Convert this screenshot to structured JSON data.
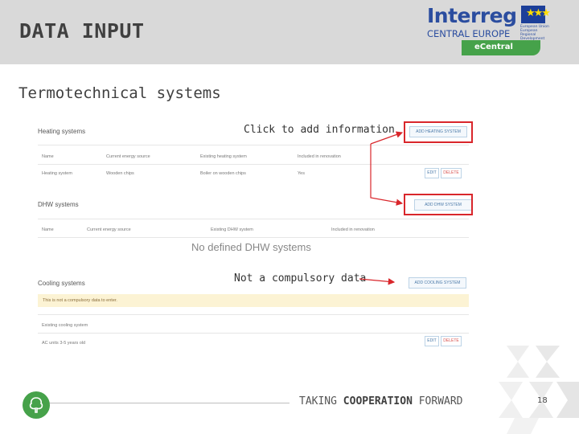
{
  "slide": {
    "title": "DATA INPUT",
    "section_title": "Termotechnical systems"
  },
  "logo": {
    "interreg": "Interreg",
    "central_europe": "CENTRAL EUROPE",
    "eu_text": "European Union European Regional Development Fund",
    "ecentral": "eCentral",
    "brand_color": "#2b4d9f",
    "green_color": "#46a24a"
  },
  "app": {
    "heating": {
      "title": "Heating systems",
      "add_button": "ADD HEATING SYSTEM",
      "columns": [
        "Name",
        "Current energy source",
        "Existing heating system",
        "Included in renovation"
      ],
      "rows": [
        {
          "name": "Heating system",
          "source": "Wooden chips",
          "system": "Boiler on wooden chips",
          "included": "Yes"
        }
      ],
      "edit_label": "EDIT",
      "delete_label": "DELETE"
    },
    "dhw": {
      "title": "DHW systems",
      "add_button": "ADD DHW SYSTEM",
      "columns": [
        "Name",
        "Current energy source",
        "Existing DHW system",
        "Included in renovation"
      ],
      "empty_message": "No defined DHW systems"
    },
    "cooling": {
      "title": "Cooling systems",
      "add_button": "ADD COOLING SYSTEM",
      "notice": "This is not a compulsory data to enter.",
      "column": "Existing cooling system",
      "rows": [
        {
          "system": "AC units 3-5 years old"
        }
      ],
      "edit_label": "EDIT",
      "delete_label": "DELETE"
    }
  },
  "callouts": {
    "add_info": "Click to add information",
    "not_compulsory": "Not a compulsory data"
  },
  "footer": {
    "text_pre": "TAKING ",
    "text_bold": "COOPERATION",
    "text_post": " FORWARD",
    "page_number": "18"
  },
  "colors": {
    "highlight": "#d9262b",
    "header_bg": "#d9d9d9"
  }
}
